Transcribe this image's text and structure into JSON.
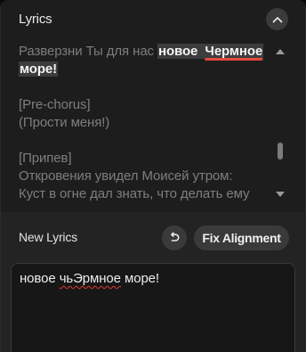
{
  "lyrics": {
    "title": "Lyrics",
    "line1_before": "Разверзни Ты для нас ",
    "line1_hl_a": "новое",
    "line1_space": " ",
    "line1_hl_b": "Чермное",
    "line1_hl_c": "море!",
    "prechorus_tag": "[Pre-chorus]",
    "prechorus_line": "(Прости меня!)",
    "chorus_tag": "[Припев]",
    "chorus_line1": "Откровения увидел Моисей утром:",
    "chorus_line2": "Куст в огне дал знать, что делать ему"
  },
  "new_lyrics": {
    "title": "New Lyrics",
    "fix_label": "Fix Alignment",
    "text_before": "новое ",
    "text_bad": "чьЭрмное",
    "text_after": " море!"
  },
  "colors": {
    "highlight_bg": "#3d3d3e",
    "spell_underline": "#e5483f",
    "panel_bg": "#1d1d1e"
  },
  "icons": {
    "collapse": "chevron-up-icon",
    "scroll_up": "triangle-up-icon",
    "scroll_down": "triangle-down-icon",
    "undo": "undo-icon"
  }
}
